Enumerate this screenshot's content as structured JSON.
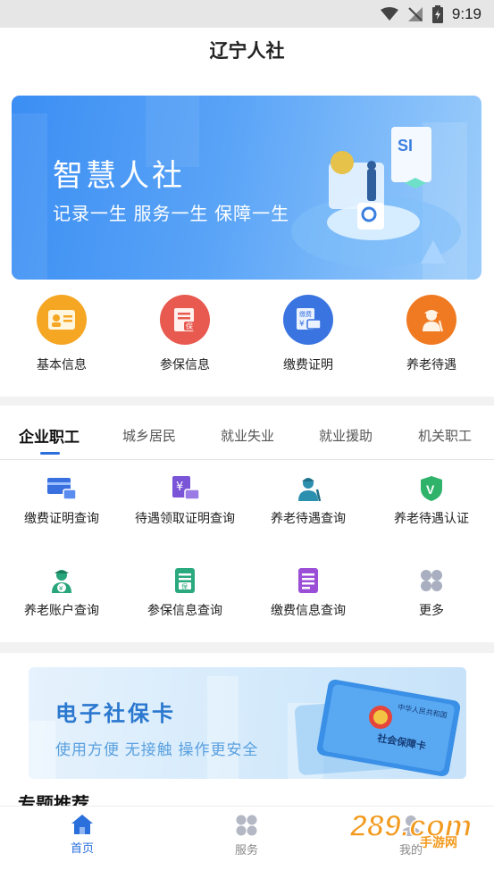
{
  "status_bar": {
    "time": "9:19"
  },
  "header": {
    "title": "辽宁人社"
  },
  "banner": {
    "slogan_main": "智慧人社",
    "slogan_sub": "记录一生  服务一生  保障一生"
  },
  "quick_actions": [
    {
      "label": "基本信息",
      "icon": "id-card-icon",
      "color": "#f5a623"
    },
    {
      "label": "参保信息",
      "icon": "insurance-doc-icon",
      "color": "#e85a4f"
    },
    {
      "label": "缴费证明",
      "icon": "payment-proof-icon",
      "color": "#3a74e0"
    },
    {
      "label": "养老待遇",
      "icon": "elder-person-icon",
      "color": "#f07a22"
    }
  ],
  "tabs": [
    {
      "label": "企业职工",
      "active": true
    },
    {
      "label": "城乡居民"
    },
    {
      "label": "就业失业"
    },
    {
      "label": "就业援助"
    },
    {
      "label": "机关职工"
    }
  ],
  "services": [
    {
      "label": "缴费证明查询",
      "icon": "card-printer-icon"
    },
    {
      "label": "待遇领取证明查询",
      "icon": "yuan-printer-icon"
    },
    {
      "label": "养老待遇查询",
      "icon": "elder-person-icon"
    },
    {
      "label": "养老待遇认证",
      "icon": "shield-check-icon"
    },
    {
      "label": "养老账户查询",
      "icon": "elder-account-icon"
    },
    {
      "label": "参保信息查询",
      "icon": "insurance-doc-icon"
    },
    {
      "label": "缴费信息查询",
      "icon": "payment-list-icon"
    },
    {
      "label": "更多",
      "icon": "more-grid-icon"
    }
  ],
  "promo_card": {
    "title": "电子社保卡",
    "subtitle": "使用方便 无接触 操作更安全",
    "card_text": "社会保障卡",
    "card_header": "中华人民共和国"
  },
  "section": {
    "title": "专题推荐"
  },
  "bottom_nav": [
    {
      "label": "首页",
      "icon": "home-icon",
      "active": true
    },
    {
      "label": "服务",
      "icon": "grid-icon"
    },
    {
      "label": "我的",
      "icon": "user-icon"
    }
  ],
  "watermark": {
    "text": "289.com",
    "sub": "手游网"
  },
  "colors": {
    "accent": "#2a6fdb",
    "banner": "#4a9af5"
  }
}
